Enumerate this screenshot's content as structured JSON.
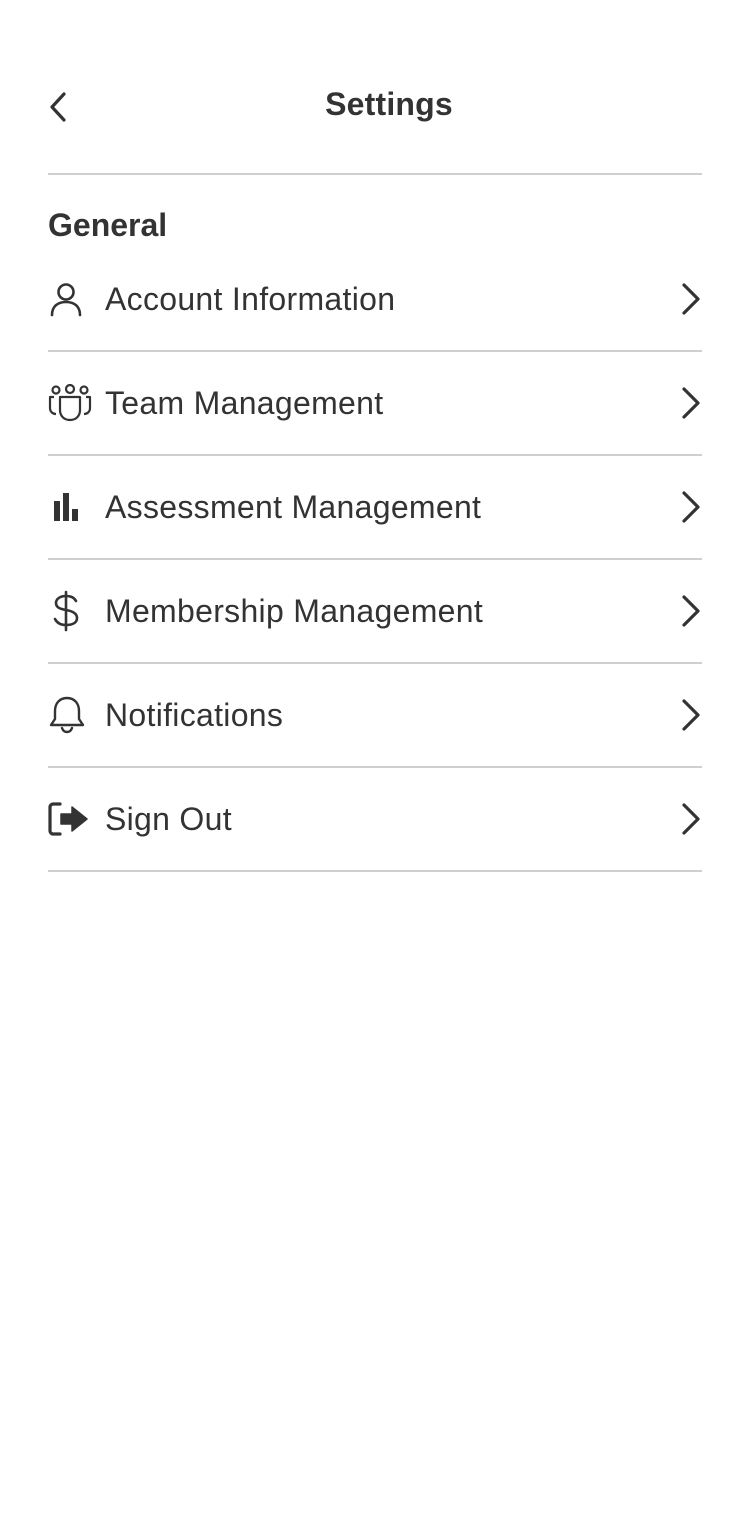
{
  "header": {
    "title": "Settings"
  },
  "section": {
    "title": "General"
  },
  "items": [
    {
      "label": "Account Information",
      "icon": "user-icon"
    },
    {
      "label": "Team Management",
      "icon": "team-icon"
    },
    {
      "label": "Assessment Management",
      "icon": "bar-chart-icon"
    },
    {
      "label": "Membership Management",
      "icon": "dollar-icon"
    },
    {
      "label": "Notifications",
      "icon": "bell-icon"
    },
    {
      "label": "Sign Out",
      "icon": "sign-out-icon"
    }
  ],
  "colors": {
    "text": "#333333",
    "divider": "#cfcfcf",
    "background": "#ffffff"
  }
}
